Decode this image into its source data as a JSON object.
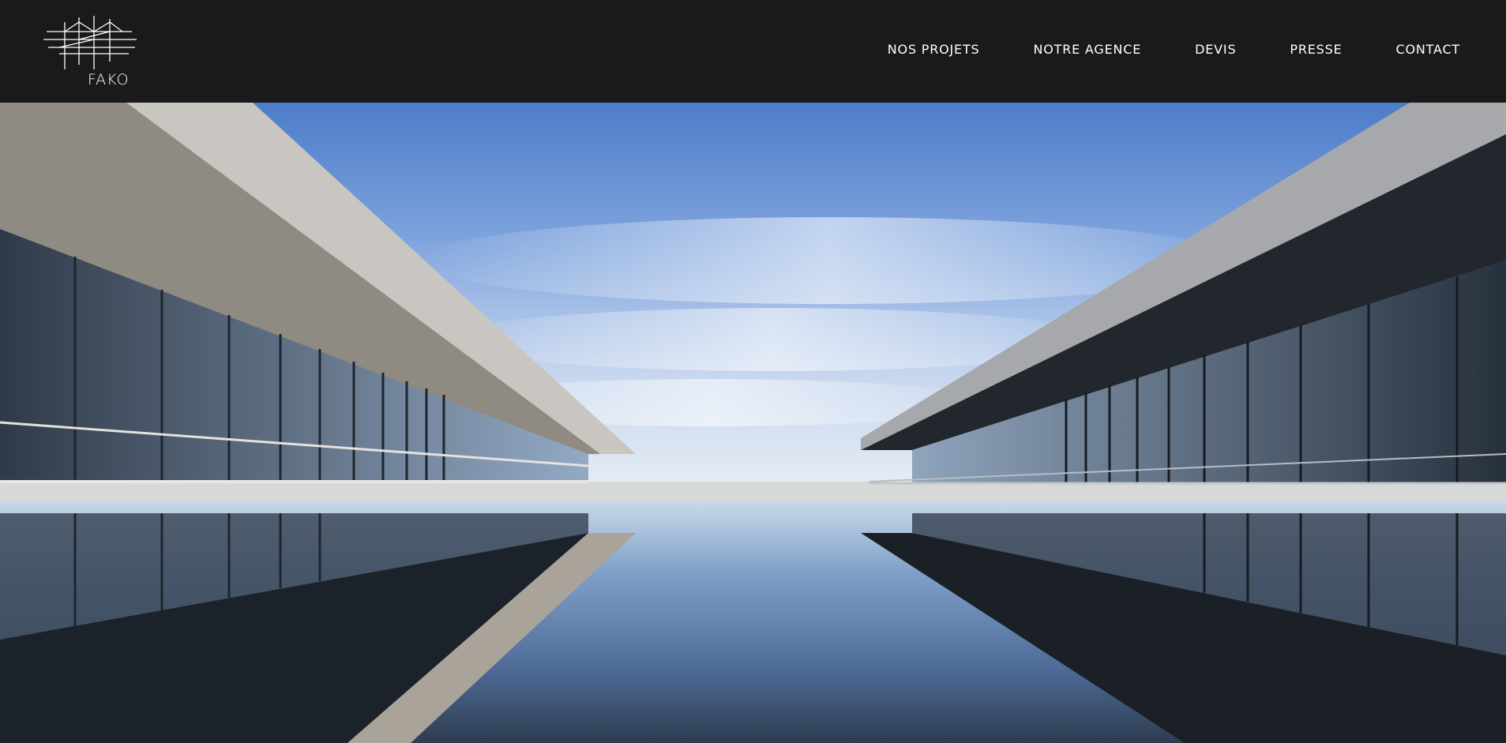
{
  "header": {
    "logo_text": "FAKO",
    "logo_icon": "building-wireframe-icon"
  },
  "nav": {
    "items": [
      {
        "label": "NOS PROJETS"
      },
      {
        "label": "NOTRE AGENCE"
      },
      {
        "label": "DEVIS"
      },
      {
        "label": "PRESSE"
      },
      {
        "label": "CONTACT"
      }
    ]
  },
  "hero": {
    "image": "architecture-reflection-photo"
  },
  "colors": {
    "header_bg": "#1a1a1a",
    "nav_text": "#ffffff",
    "sky_top": "#5a86cf",
    "sky_bottom": "#dfe8f2"
  }
}
